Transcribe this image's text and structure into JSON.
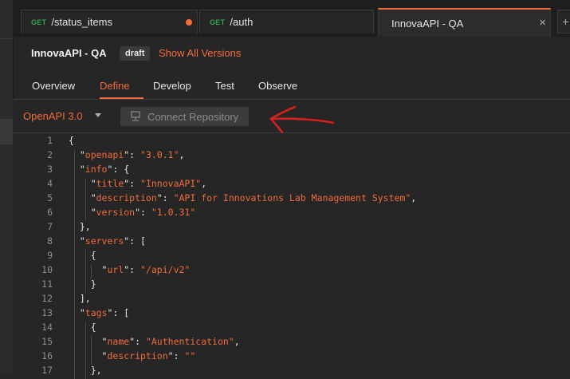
{
  "tabs": [
    {
      "method": "GET",
      "name": "/status_items",
      "unsaved": true
    },
    {
      "method": "GET",
      "name": "/auth",
      "unsaved": false
    },
    {
      "method": "",
      "name": "InnovaAPI - QA",
      "active": true,
      "close_glyph": "×"
    }
  ],
  "new_tab_glyph": "+",
  "header": {
    "title": "InnovaAPI - QA",
    "badge": "draft",
    "versions_link": "Show All Versions"
  },
  "subtabs": [
    "Overview",
    "Define",
    "Develop",
    "Test",
    "Observe"
  ],
  "active_subtab": "Define",
  "toolbar": {
    "spec_version": "OpenAPI 3.0",
    "connect_label": "Connect Repository"
  },
  "accent_color": "#f26b3a",
  "editor": {
    "lines": [
      {
        "n": "1",
        "t": "{"
      },
      {
        "n": "2",
        "t": "  \"openapi\": \"3.0.1\","
      },
      {
        "n": "3",
        "t": "  \"info\": {"
      },
      {
        "n": "4",
        "t": "    \"title\": \"InnovaAPI\","
      },
      {
        "n": "5",
        "t": "    \"description\": \"API for Innovations Lab Management System\","
      },
      {
        "n": "6",
        "t": "    \"version\": \"1.0.31\""
      },
      {
        "n": "7",
        "t": "  },"
      },
      {
        "n": "8",
        "t": "  \"servers\": ["
      },
      {
        "n": "9",
        "t": "    {"
      },
      {
        "n": "10",
        "t": "      \"url\": \"/api/v2\""
      },
      {
        "n": "11",
        "t": "    }"
      },
      {
        "n": "12",
        "t": "  ],"
      },
      {
        "n": "13",
        "t": "  \"tags\": ["
      },
      {
        "n": "14",
        "t": "    {"
      },
      {
        "n": "15",
        "t": "      \"name\": \"Authentication\","
      },
      {
        "n": "16",
        "t": "      \"description\": \"\""
      },
      {
        "n": "17",
        "t": "    },"
      }
    ]
  }
}
